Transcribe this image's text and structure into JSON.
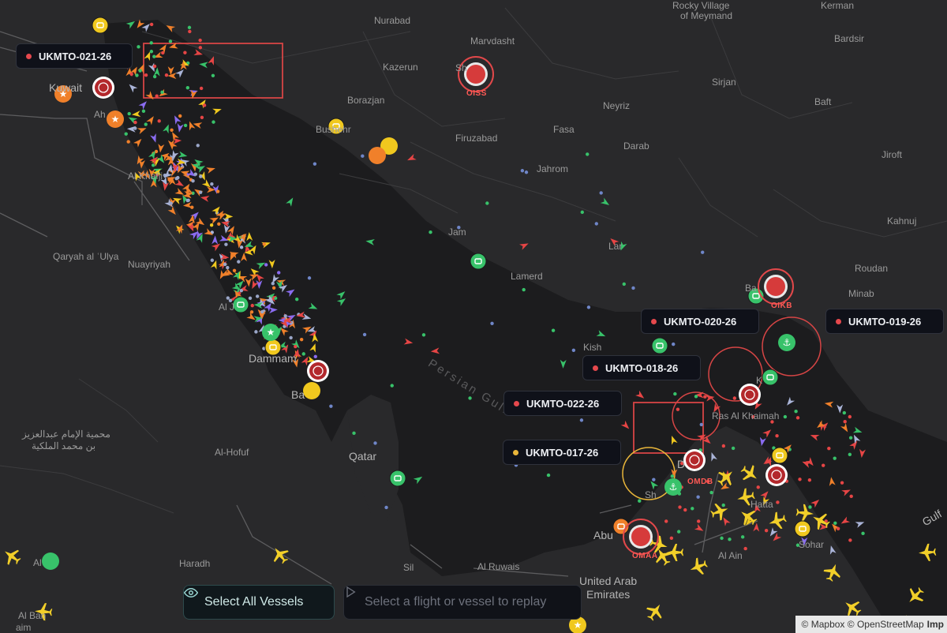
{
  "map": {
    "places": [
      {
        "id": "rocky-village",
        "text": "Rocky Village"
      },
      {
        "id": "of-meymand",
        "text": "of Meymand"
      },
      {
        "id": "kerman",
        "text": "Kerman"
      },
      {
        "id": "nurabad",
        "text": "Nurabad"
      },
      {
        "id": "marvdasht",
        "text": "Marvdasht"
      },
      {
        "id": "bardsir",
        "text": "Bardsir"
      },
      {
        "id": "kazerun",
        "text": "Kazerun"
      },
      {
        "id": "shiraz",
        "text": "Sh"
      },
      {
        "id": "sirjan",
        "text": "Sirjan"
      },
      {
        "id": "borazjan",
        "text": "Borazjan"
      },
      {
        "id": "neyriz",
        "text": "Neyriz"
      },
      {
        "id": "baft",
        "text": "Baft"
      },
      {
        "id": "bushehr",
        "text": "Bushehr"
      },
      {
        "id": "fasa",
        "text": "Fasa"
      },
      {
        "id": "firuzabad",
        "text": "Firuzabad"
      },
      {
        "id": "darab",
        "text": "Darab"
      },
      {
        "id": "jiroft",
        "text": "Jiroft"
      },
      {
        "id": "kuwait",
        "text": "Kuwait"
      },
      {
        "id": "ahmadi",
        "text": "Ah"
      },
      {
        "id": "al-khafji",
        "text": "Al Khafji"
      },
      {
        "id": "jahrom",
        "text": "Jahrom"
      },
      {
        "id": "kahnuj",
        "text": "Kahnuj"
      },
      {
        "id": "jam",
        "text": "Jam"
      },
      {
        "id": "qaryah",
        "text": "Qaryah al ʿUlya"
      },
      {
        "id": "nuayriyah",
        "text": "Nuayriyah"
      },
      {
        "id": "lar",
        "text": "Lar"
      },
      {
        "id": "roudan",
        "text": "Roudan"
      },
      {
        "id": "lamerd",
        "text": "Lamerd"
      },
      {
        "id": "bandar-abbas",
        "text": "Ba"
      },
      {
        "id": "minab",
        "text": "Minab"
      },
      {
        "id": "al-jubail",
        "text": "Al J"
      },
      {
        "id": "kish",
        "text": "Kish"
      },
      {
        "id": "dammam",
        "text": "Dammam"
      },
      {
        "id": "bahrain",
        "text": "Ba"
      },
      {
        "id": "khasab",
        "text": "K"
      },
      {
        "id": "persian-gulf",
        "text": "Persian Gulf"
      },
      {
        "id": "ras-al-khaimah",
        "text": "Ras Al Khaimah"
      },
      {
        "id": "imam-1",
        "text": "محمية الإمام عبدالعزيز"
      },
      {
        "id": "imam-2",
        "text": "بن محمد الملكية"
      },
      {
        "id": "al-hofuf",
        "text": "Al-Hofuf"
      },
      {
        "id": "qatar",
        "text": "Qatar"
      },
      {
        "id": "dubai",
        "text": "D"
      },
      {
        "id": "sharjah",
        "text": "Sh"
      },
      {
        "id": "hatta",
        "text": "Hatta"
      },
      {
        "id": "gulf-oman",
        "text": "Gulf"
      },
      {
        "id": "abu-dhabi",
        "text": "Abu"
      },
      {
        "id": "sohar",
        "text": "Sohar"
      },
      {
        "id": "al-ain",
        "text": "Al Ain"
      },
      {
        "id": "haradh",
        "text": "Haradh"
      },
      {
        "id": "al-ruwais",
        "text": "Al Ruwais"
      },
      {
        "id": "sila",
        "text": "Sil"
      },
      {
        "id": "uae-1",
        "text": "United Arab"
      },
      {
        "id": "uae-2",
        "text": "Emirates"
      },
      {
        "id": "al-banban",
        "text": "Al Ban"
      },
      {
        "id": "aim",
        "text": "aim"
      },
      {
        "id": "al-ab",
        "text": "Al"
      }
    ],
    "airports": [
      "OISS",
      "OIKB",
      "OMDB",
      "OMAA"
    ],
    "alerts": [
      {
        "id": "021",
        "label": "UKMTO-021-26",
        "color": "#e5484d"
      },
      {
        "id": "020",
        "label": "UKMTO-020-26",
        "color": "#e5484d"
      },
      {
        "id": "019",
        "label": "UKMTO-019-26",
        "color": "#e5484d"
      },
      {
        "id": "018",
        "label": "UKMTO-018-26",
        "color": "#e5484d"
      },
      {
        "id": "022",
        "label": "UKMTO-022-26",
        "color": "#e5484d"
      },
      {
        "id": "017",
        "label": "UKMTO-017-26",
        "color": "#e8b53a"
      }
    ],
    "colors": {
      "tanker": "#f0802a",
      "cargo": "#f0c81e",
      "passenger": "#38c26a",
      "alert_ring": "#e2484a",
      "aircraft": "#f2cf29",
      "background": "#202022",
      "land": "#2a2a2c"
    }
  },
  "controls": {
    "select_all": "Select All Vessels",
    "select_all_icon": "eye-icon",
    "replay": "Select a flight or vessel to replay",
    "replay_icon": "play-icon"
  },
  "attribution": {
    "mapbox": "© Mapbox",
    "osm": "© OpenStreetMap",
    "improve": "Imp"
  }
}
